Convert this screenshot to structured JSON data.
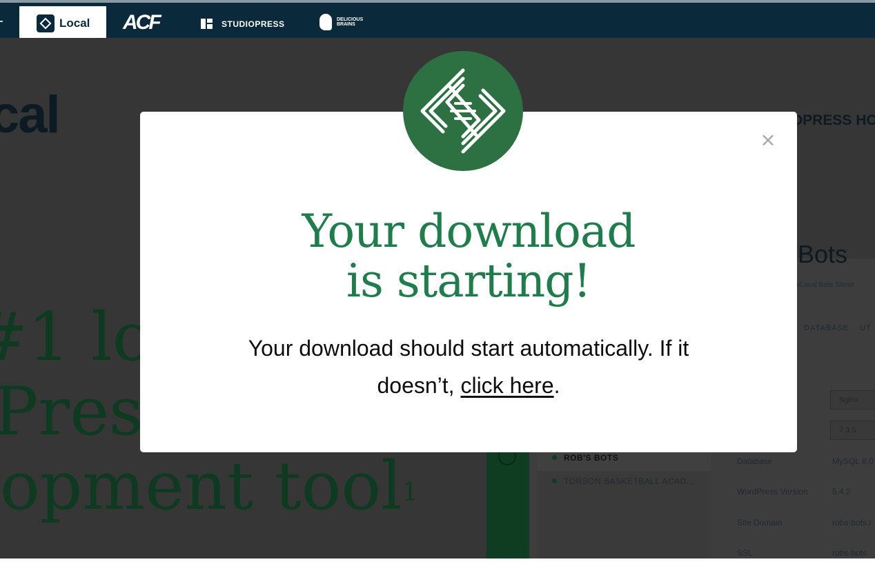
{
  "topbar": {
    "tabs": [
      {
        "label": "Local",
        "active": true
      },
      {
        "label": "ACF"
      },
      {
        "label": "STUDIOPRESS"
      },
      {
        "label": "DELICIOUS BRAINS"
      }
    ]
  },
  "background": {
    "heading": "cal",
    "hero_lines": [
      "#1 loc",
      "lPres",
      "opment tool"
    ],
    "hero_superscript": "1",
    "right_title": "DPRESS HO",
    "app": {
      "site_title": "; Bots",
      "path": "s/Local Beta Sites/r",
      "tabs": [
        "DATABASE",
        "UT"
      ],
      "server_select": "Nginx",
      "php_select": "7.3.5",
      "sites": [
        "ROB'S BOTS",
        "TORSON BASKETBALL ACAD..."
      ],
      "rows": [
        {
          "label": "Database",
          "value": "MySQL 8.0"
        },
        {
          "label": "WordPress Version",
          "value": "5.4.2"
        },
        {
          "label": "Site Domain",
          "value": "robs-bots.l"
        },
        {
          "label": "SSL",
          "value": "robs-bots"
        }
      ]
    }
  },
  "modal": {
    "title_line1": "Your download",
    "title_line2": "is starting!",
    "message_line1": "Your download should start automatically. If it",
    "message_prefix": "doesn’t, ",
    "link_text": "click here",
    "message_suffix": ".",
    "close_symbol": "×"
  },
  "colors": {
    "topbar": "#0a2a3c",
    "overlay": "#363636",
    "brand_green": "#2d7042",
    "title_green": "#1f7d4c"
  },
  "icons": [
    "local-logo-icon",
    "studiopress-icon",
    "delicious-brains-icon",
    "local-diamond-logo-icon",
    "close-icon"
  ]
}
